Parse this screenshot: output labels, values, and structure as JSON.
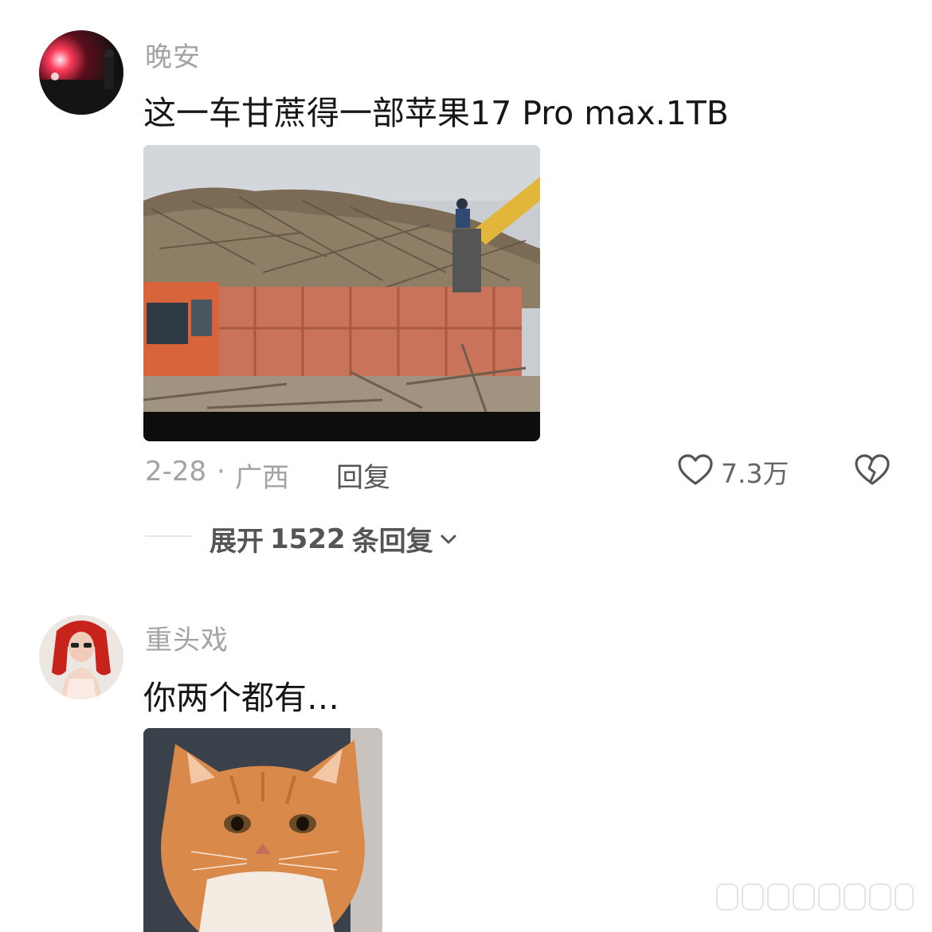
{
  "comments": [
    {
      "username": "晚安",
      "text": "这一车甘蔗得一部苹果17 Pro max.1TB",
      "date": "2-28",
      "separator": "·",
      "location": "广西",
      "reply_label": "回复",
      "like_count": "7.3万",
      "expand": {
        "prefix": "展开",
        "count": "1522",
        "suffix": "条回复"
      }
    },
    {
      "username": "重头戏",
      "text": "你两个都有…"
    }
  ],
  "icons": {
    "like": "heart-outline-icon",
    "dislike": "broken-heart-icon",
    "expand": "chevron-down-icon"
  },
  "colors": {
    "username": "#a3a3a3",
    "text": "#161616",
    "meta": "#a3a3a3",
    "action": "#555555"
  }
}
